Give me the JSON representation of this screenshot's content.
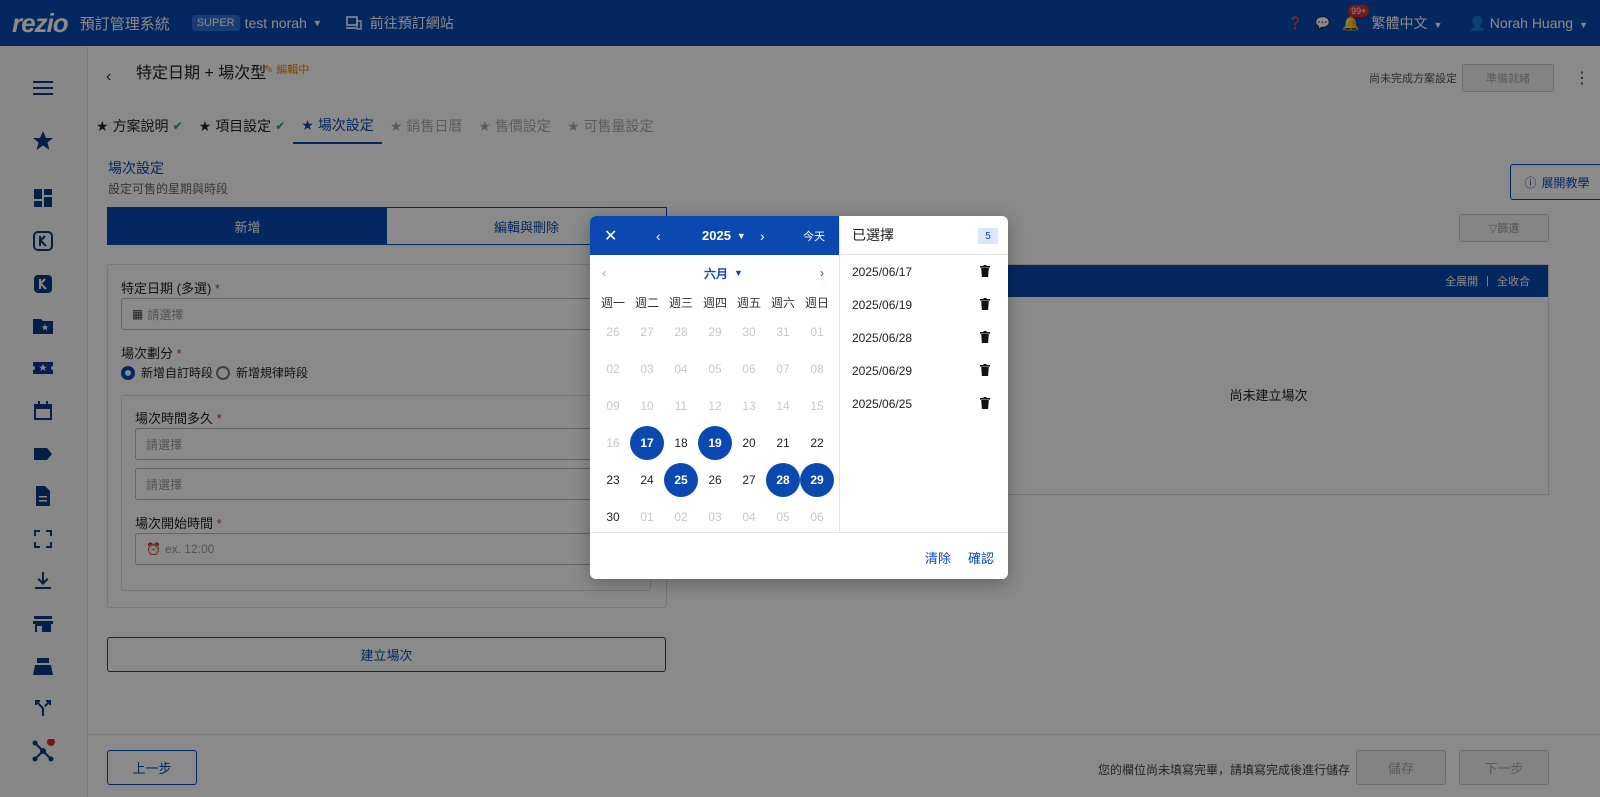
{
  "topbar": {
    "logo": "rezio",
    "system_title": "預訂管理系統",
    "super_badge": "SUPER",
    "account": "test norah",
    "goto_site": "前往預訂網站",
    "notif_count": "99+",
    "language": "繁體中文",
    "user": "Norah Huang"
  },
  "header": {
    "title": "特定日期 + 場次型",
    "editing": "編輯中",
    "unfinished": "尚未完成方案設定",
    "ready_button": "準備就緒"
  },
  "tabs": [
    {
      "label": "方案說明",
      "state": "done"
    },
    {
      "label": "項目設定",
      "state": "done"
    },
    {
      "label": "場次設定",
      "state": "active"
    },
    {
      "label": "銷售日曆",
      "state": "disabled"
    },
    {
      "label": "售價設定",
      "state": "disabled"
    },
    {
      "label": "可售量設定",
      "state": "disabled"
    }
  ],
  "section": {
    "title": "場次設定",
    "subtitle": "設定可售的星期與時段",
    "tutorial": "展開教學",
    "seg_add": "新增",
    "seg_edit": "編輯與刪除"
  },
  "form": {
    "date_label": "特定日期 (多選)",
    "date_placeholder": "請選擇",
    "division_label": "場次劃分",
    "radio_custom": "新增自訂時段",
    "radio_regular": "新增規律時段",
    "duration_label": "場次時間多久",
    "duration_placeholder1": "請選擇",
    "duration_placeholder2": "請選擇",
    "start_label": "場次開始時間",
    "start_placeholder": "ex. 12:00",
    "create_button": "建立場次"
  },
  "sessions": {
    "filter": "篩選",
    "expand_all": "全展開",
    "separator": "|",
    "collapse_all": "全收合",
    "empty": "尚未建立場次"
  },
  "footer": {
    "prev": "上一步",
    "message": "您的欄位尚未填寫完畢，請填寫完成後進行儲存",
    "save": "儲存",
    "next": "下一步"
  },
  "picker": {
    "close": "✕",
    "year": "2025",
    "today": "今天",
    "month": "六月",
    "weekdays": [
      "週一",
      "週二",
      "週三",
      "週四",
      "週五",
      "週六",
      "週日"
    ],
    "weeks": [
      [
        {
          "d": "26",
          "m": 1
        },
        {
          "d": "27",
          "m": 1
        },
        {
          "d": "28",
          "m": 1
        },
        {
          "d": "29",
          "m": 1
        },
        {
          "d": "30",
          "m": 1
        },
        {
          "d": "31",
          "m": 1
        },
        {
          "d": "01",
          "m": 1
        }
      ],
      [
        {
          "d": "02",
          "m": 1
        },
        {
          "d": "03",
          "m": 1
        },
        {
          "d": "04",
          "m": 1
        },
        {
          "d": "05",
          "m": 1
        },
        {
          "d": "06",
          "m": 1
        },
        {
          "d": "07",
          "m": 1
        },
        {
          "d": "08",
          "m": 1
        }
      ],
      [
        {
          "d": "09",
          "m": 1
        },
        {
          "d": "10",
          "m": 1
        },
        {
          "d": "11",
          "m": 1
        },
        {
          "d": "12",
          "m": 1
        },
        {
          "d": "13",
          "m": 1
        },
        {
          "d": "14",
          "m": 1
        },
        {
          "d": "15",
          "m": 1
        }
      ],
      [
        {
          "d": "16",
          "m": 1
        },
        {
          "d": "17",
          "s": 1
        },
        {
          "d": "18"
        },
        {
          "d": "19",
          "s": 1
        },
        {
          "d": "20"
        },
        {
          "d": "21"
        },
        {
          "d": "22"
        }
      ],
      [
        {
          "d": "23"
        },
        {
          "d": "24"
        },
        {
          "d": "25",
          "s": 1
        },
        {
          "d": "26"
        },
        {
          "d": "27"
        },
        {
          "d": "28",
          "s": 1
        },
        {
          "d": "29",
          "s": 1
        }
      ],
      [
        {
          "d": "30"
        },
        {
          "d": "01",
          "m": 1
        },
        {
          "d": "02",
          "m": 1
        },
        {
          "d": "03",
          "m": 1
        },
        {
          "d": "04",
          "m": 1
        },
        {
          "d": "05",
          "m": 1
        },
        {
          "d": "06",
          "m": 1
        }
      ]
    ],
    "selected_title": "已選擇",
    "selected_count": "5",
    "selected_dates": [
      "2025/06/17",
      "2025/06/19",
      "2025/06/28",
      "2025/06/29",
      "2025/06/25"
    ],
    "clear": "清除",
    "confirm": "確認"
  },
  "sidebar_icons": [
    "menu-icon",
    "star-icon",
    "dashboard-icon",
    "k-outline-icon",
    "k-filled-icon",
    "folder-star-icon",
    "ticket-star-icon",
    "calendar-icon",
    "label-icon",
    "document-icon",
    "fullscreen-icon",
    "download-icon",
    "store-icon",
    "register-icon",
    "merge-icon",
    "network-icon"
  ],
  "colors": {
    "primary": "#0b48b0",
    "editing": "#e58a00",
    "success": "#2e9e44",
    "alert": "#d32f2f"
  }
}
